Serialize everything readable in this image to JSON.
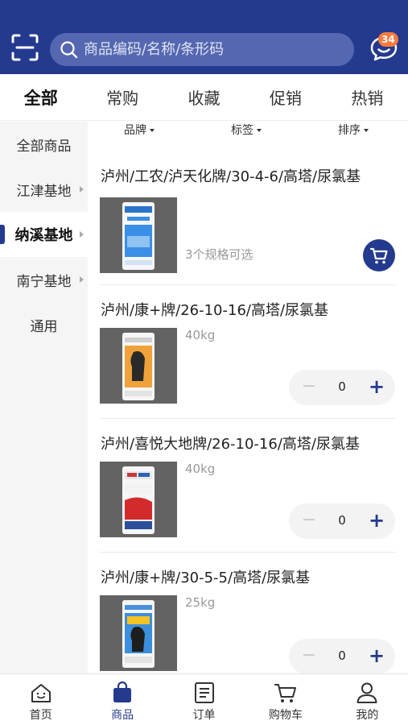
{
  "search": {
    "placeholder": "商品编码/名称/条形码"
  },
  "messages": {
    "badge": "34"
  },
  "tabs": [
    {
      "label": "全部",
      "active": true
    },
    {
      "label": "常购"
    },
    {
      "label": "收藏"
    },
    {
      "label": "促销"
    },
    {
      "label": "热销"
    }
  ],
  "sidebar": {
    "items": [
      {
        "label": "全部商品"
      },
      {
        "label": "江津基地"
      },
      {
        "label": "纳溪基地",
        "active": true
      },
      {
        "label": "南宁基地"
      },
      {
        "label": "通用"
      }
    ]
  },
  "filters": {
    "brand": "品牌",
    "tag": "标签",
    "sort": "排序"
  },
  "products": [
    {
      "name": "泸州/工农/泸天化牌/30-4-6/高塔/尿氯基",
      "spec": "3个规格可选",
      "action": "cart"
    },
    {
      "name": "泸州/康+牌/26-10-16/高塔/尿氯基",
      "spec": "40kg",
      "quantity": "0",
      "action": "stepper"
    },
    {
      "name": "泸州/喜悦大地牌/26-10-16/高塔/尿氯基",
      "spec": "40kg",
      "quantity": "0",
      "action": "stepper"
    },
    {
      "name": "泸州/康+牌/30-5-5/高塔/尿氯基",
      "spec": "25kg",
      "quantity": "0",
      "action": "stepper"
    }
  ],
  "bottom_nav": [
    {
      "label": "首页",
      "icon": "home-icon"
    },
    {
      "label": "商品",
      "icon": "bag-icon",
      "active": true
    },
    {
      "label": "订单",
      "icon": "order-icon"
    },
    {
      "label": "购物车",
      "icon": "cart-icon"
    },
    {
      "label": "我的",
      "icon": "user-icon"
    }
  ],
  "colors": {
    "primary": "#243a8f",
    "badge": "#ff7a3c",
    "sidebar_bg": "#f5f5f5"
  }
}
